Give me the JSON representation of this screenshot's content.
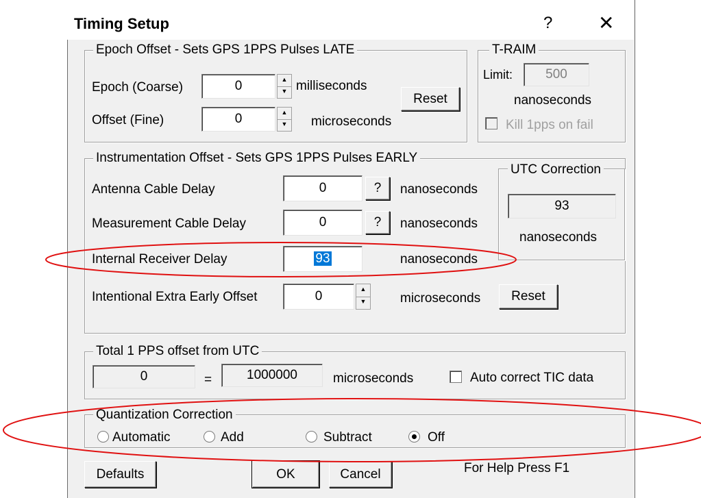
{
  "window": {
    "title": "Timing Setup",
    "help_glyph": "?",
    "close_glyph": "✕"
  },
  "epoch_group": {
    "legend": "Epoch Offset - Sets GPS 1PPS Pulses LATE",
    "epoch_label": "Epoch (Coarse)",
    "epoch_value": "0",
    "epoch_unit": "milliseconds",
    "offset_label": "Offset (Fine)",
    "offset_value": "0",
    "offset_unit": "microseconds",
    "reset_label": "Reset"
  },
  "traim_group": {
    "legend": "T-RAIM",
    "limit_label": "Limit:",
    "limit_value": "500",
    "unit": "nanoseconds",
    "kill_label": "Kill 1pps on fail"
  },
  "instrumentation_group": {
    "legend": "Instrumentation Offset - Sets GPS 1PPS Pulses EARLY",
    "antenna_label": "Antenna Cable Delay",
    "antenna_value": "0",
    "measurement_label": "Measurement Cable Delay",
    "measurement_value": "0",
    "internal_label": "Internal Receiver Delay",
    "internal_value": "93",
    "extra_label": "Intentional Extra Early Offset",
    "extra_value": "0",
    "help_button": "?",
    "nano_unit": "nanoseconds",
    "micro_unit": "microseconds",
    "reset_label": "Reset"
  },
  "utc_group": {
    "legend": "UTC Correction",
    "value": "93",
    "unit": "nanoseconds"
  },
  "total_group": {
    "legend": "Total 1 PPS offset from UTC",
    "left_value": "0",
    "equals": "=",
    "right_value": "1000000",
    "unit": "microseconds",
    "auto_correct_label": "Auto correct TIC data"
  },
  "quantization_group": {
    "legend": "Quantization Correction",
    "options": [
      {
        "label": "Automatic",
        "checked": false
      },
      {
        "label": "Add",
        "checked": false
      },
      {
        "label": "Subtract",
        "checked": false
      },
      {
        "label": "Off",
        "checked": true
      }
    ]
  },
  "footer": {
    "defaults": "Defaults",
    "ok": "OK",
    "cancel": "Cancel",
    "help_hint": "For Help Press F1"
  },
  "colors": {
    "annotation_red": "#e01010",
    "selection_blue": "#0078d7",
    "dialog_bg": "#f0f0f0"
  }
}
